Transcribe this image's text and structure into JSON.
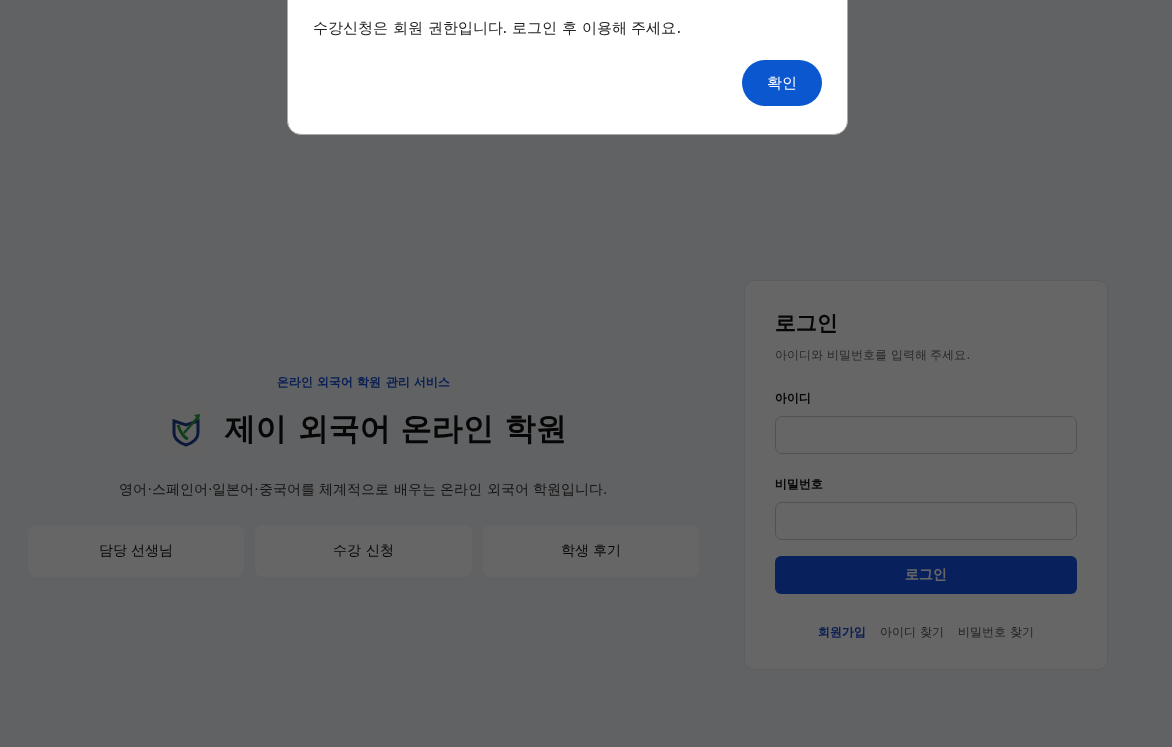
{
  "dialog": {
    "message": "수강신청은 회원 권한입니다. 로그인 후 이용해 주세요.",
    "confirm_button": "확인"
  },
  "hero": {
    "kicker": "온라인 외국어 학원 관리 서비스",
    "title": "제이 외국어 온라인 학원",
    "description": "영어·스페인어·일본어·중국어를 체계적으로 배우는 온라인 외국어 학원입니다.",
    "buttons": [
      "담당 선생님",
      "수강 신청",
      "학생 후기"
    ]
  },
  "login": {
    "title": "로그인",
    "subtitle": "아이디와 비밀번호를 입력해 주세요.",
    "fields": [
      {
        "label": "아이디"
      },
      {
        "label": "비밀번호"
      }
    ],
    "submit": "로그인",
    "links": [
      {
        "label": "회원가입",
        "kind": "primary"
      },
      {
        "label": "아이디 찾기",
        "kind": "plain"
      },
      {
        "label": "비밀번호 찾기",
        "kind": "plain"
      }
    ]
  }
}
